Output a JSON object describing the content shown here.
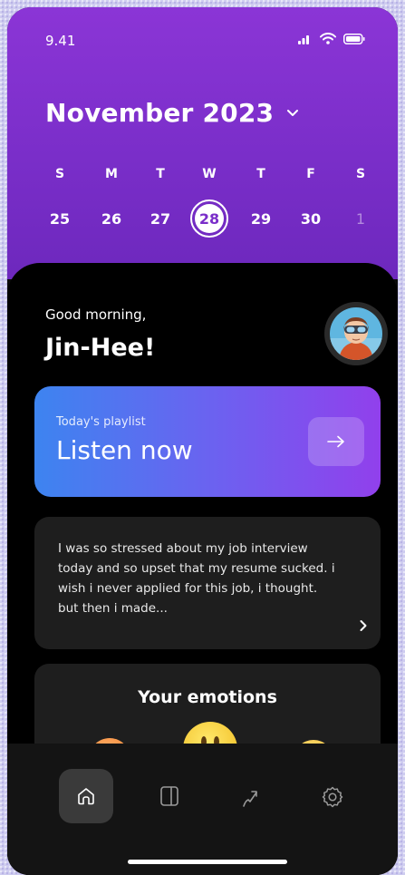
{
  "status_bar": {
    "time": "9.41",
    "icons": [
      "signal-icon",
      "wifi-icon",
      "battery-icon"
    ]
  },
  "calendar": {
    "month_label": "November 2023",
    "weekdays": [
      "S",
      "M",
      "T",
      "W",
      "T",
      "F",
      "S"
    ],
    "dates": [
      "25",
      "26",
      "27",
      "28",
      "29",
      "30",
      "1"
    ],
    "selected": "28"
  },
  "greeting": {
    "line1": "Good morning,",
    "name": "Jin-Hee!"
  },
  "playlist": {
    "subtitle": "Today's playlist",
    "title": "Listen now",
    "arrow": "→"
  },
  "journal": {
    "text": "I was so stressed about my job interview  today and so upset that my resume sucked. i wish i never applied for this job, i thought. but then i made..."
  },
  "emotions": {
    "title": "Your emotions"
  },
  "nav": {
    "items": [
      "home-icon",
      "journal-icon",
      "stats-icon",
      "settings-icon"
    ],
    "active": "home-icon"
  },
  "colors": {
    "header_purple": "#7a2ec9",
    "playlist_start": "#3d84f0",
    "playlist_end": "#9140ec",
    "card_bg": "#1e1e1e",
    "nav_bg": "#141414"
  }
}
